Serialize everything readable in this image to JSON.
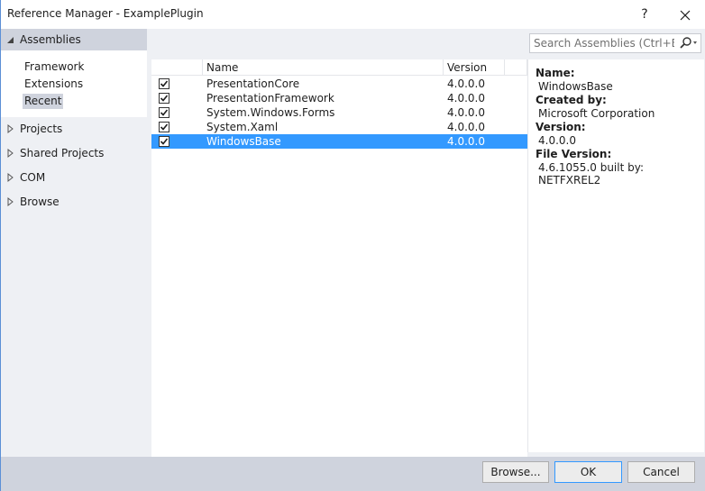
{
  "window": {
    "title": "Reference Manager - ExamplePlugin",
    "help_label": "?",
    "accent_color": "#3399ff"
  },
  "nav": {
    "assemblies": {
      "label": "Assemblies",
      "expanded": true,
      "items": [
        {
          "label": "Framework",
          "selected": false
        },
        {
          "label": "Extensions",
          "selected": false
        },
        {
          "label": "Recent",
          "selected": true
        }
      ]
    },
    "sections": [
      {
        "label": "Projects"
      },
      {
        "label": "Shared Projects"
      },
      {
        "label": "COM"
      },
      {
        "label": "Browse"
      }
    ]
  },
  "search": {
    "placeholder": "Search Assemblies (Ctrl+E)",
    "value": "",
    "icon": "search-icon"
  },
  "list": {
    "columns": {
      "name": "Name",
      "version": "Version"
    },
    "rows": [
      {
        "name": "PresentationCore",
        "version": "4.0.0.0",
        "checked": true,
        "selected": false
      },
      {
        "name": "PresentationFramework",
        "version": "4.0.0.0",
        "checked": true,
        "selected": false
      },
      {
        "name": "System.Windows.Forms",
        "version": "4.0.0.0",
        "checked": true,
        "selected": false
      },
      {
        "name": "System.Xaml",
        "version": "4.0.0.0",
        "checked": true,
        "selected": false
      },
      {
        "name": "WindowsBase",
        "version": "4.0.0.0",
        "checked": true,
        "selected": true
      }
    ]
  },
  "details": {
    "name_label": "Name:",
    "name": "WindowsBase",
    "created_by_label": "Created by:",
    "created_by": "Microsoft Corporation",
    "version_label": "Version:",
    "version": "4.0.0.0",
    "file_version_label": "File Version:",
    "file_version": "4.6.1055.0 built by: NETFXREL2"
  },
  "footer": {
    "browse_label": "Browse...",
    "ok_label": "OK",
    "cancel_label": "Cancel"
  }
}
